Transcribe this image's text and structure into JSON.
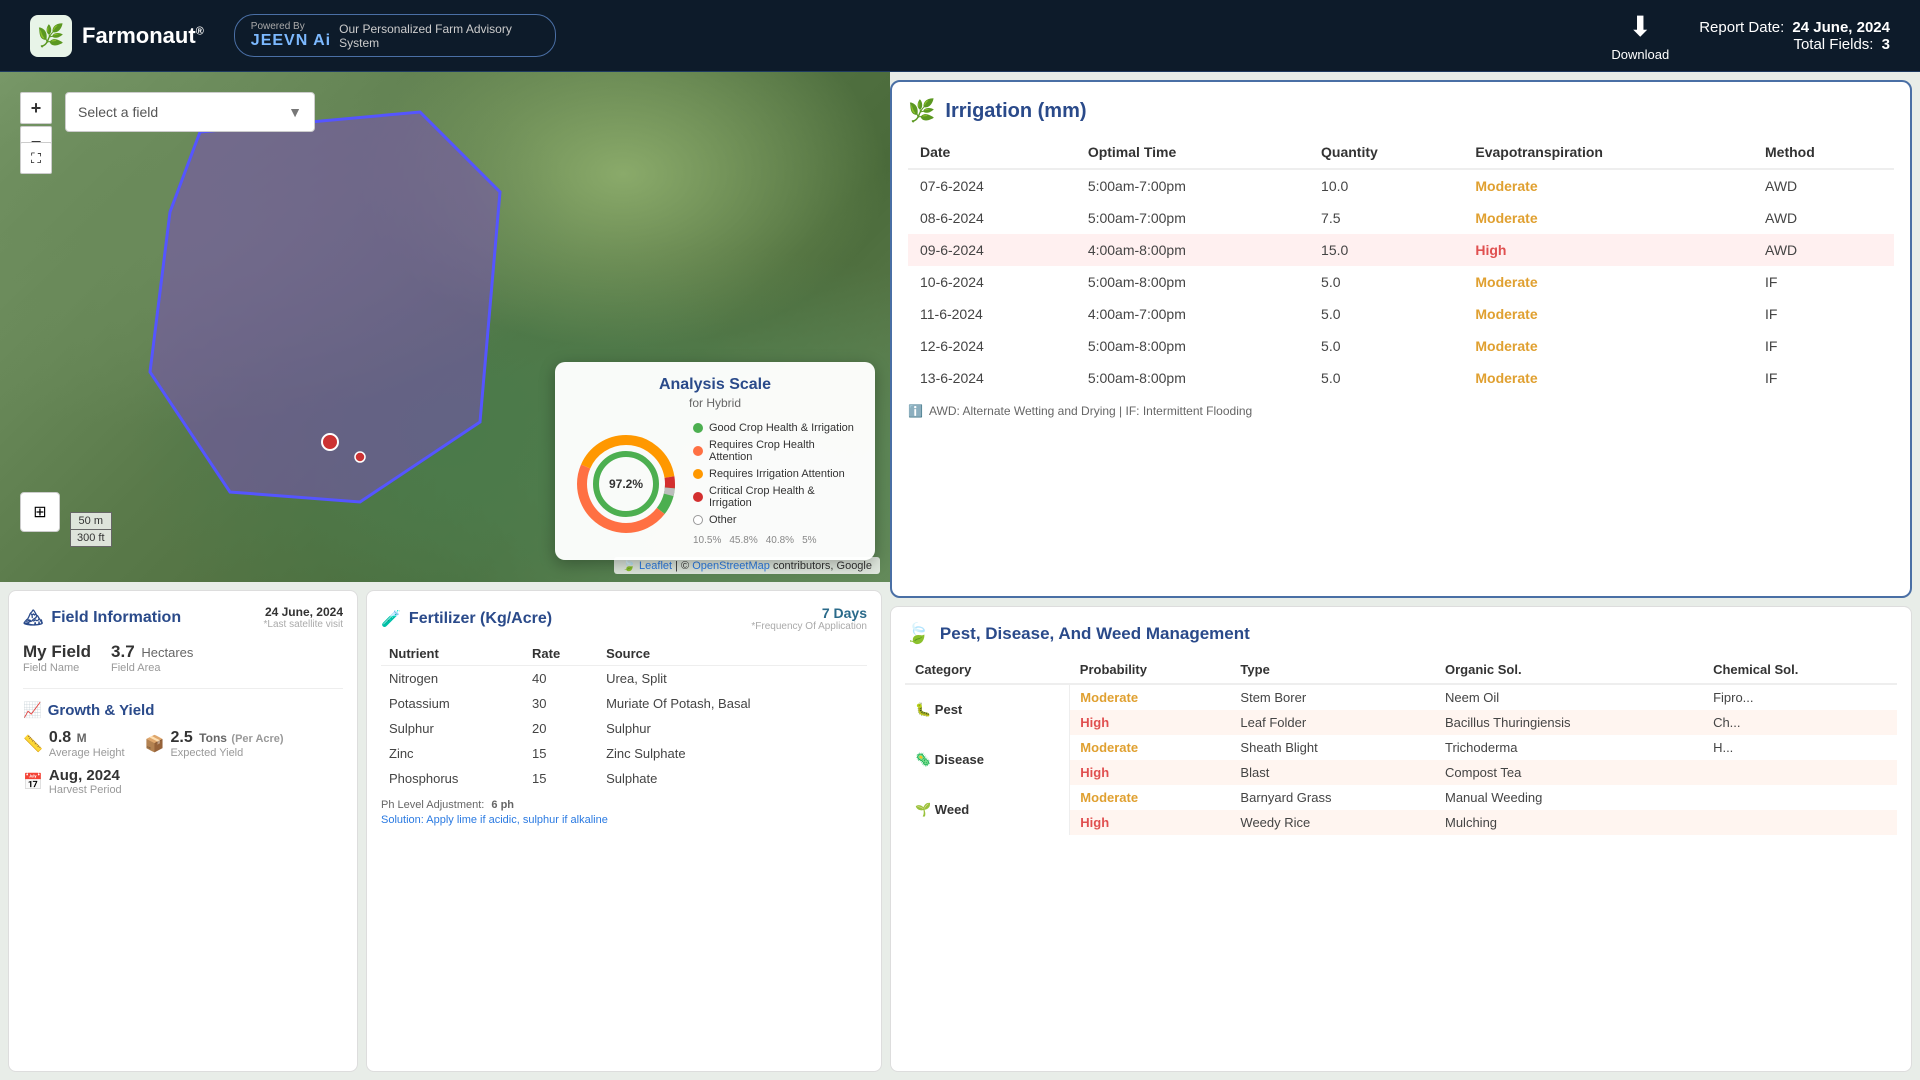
{
  "header": {
    "logo_text": "Farmonaut",
    "logo_reg": "®",
    "jeevn_name": "JEEVN Ai",
    "powered_by": "Powered By",
    "jeevn_subtitle": "Our Personalized Farm Advisory System",
    "download_label": "Download",
    "report_date_label": "Report Date:",
    "report_date_value": "24 June, 2024",
    "total_fields_label": "Total Fields:",
    "total_fields_value": "3"
  },
  "map": {
    "field_select_placeholder": "Select a field",
    "scale_m": "50 m",
    "scale_ft": "300 ft",
    "attribution": "Leaflet | © OpenStreetMap contributors, Google"
  },
  "analysis_scale": {
    "title": "Analysis Scale",
    "subtitle": "for Hybrid",
    "percent_97": "97.2%",
    "percent_10": "10.5%",
    "percent_45": "45.8%",
    "percent_40": "40.8%",
    "percent_5": "5%",
    "legend": [
      {
        "color": "#4caf50",
        "label": "Good Crop Health & Irrigation"
      },
      {
        "color": "#ff7043",
        "label": "Requires Crop Health Attention"
      },
      {
        "color": "#ff9800",
        "label": "Requires Irrigation Attention"
      },
      {
        "color": "#d32f2f",
        "label": "Critical Crop Health & Irrigation"
      },
      {
        "color": "#bdbdbd",
        "label": "Other",
        "border": true
      }
    ]
  },
  "field_info": {
    "title": "Field Information",
    "icon": "🏔",
    "date": "24 June, 2024",
    "last_satellite": "*Last satellite visit",
    "field_name_label": "Field Name",
    "field_name_value": "My Field",
    "field_area_label": "Field Area",
    "field_area_value": "3.7",
    "field_area_unit": "Hectares",
    "growth_title": "Growth & Yield",
    "avg_height_val": "0.8",
    "avg_height_unit": "M",
    "avg_height_label": "Average Height",
    "expected_yield_val": "2.5",
    "expected_yield_unit": "Tons",
    "expected_yield_per": "(Per Acre)",
    "expected_yield_label": "Expected Yield",
    "harvest_month": "Aug, 2024",
    "harvest_label": "Harvest Period"
  },
  "fertilizer": {
    "title": "Fertilizer (Kg/Acre)",
    "icon": "🧪",
    "freq_val": "7 Days",
    "freq_label": "*Frequency Of Application",
    "headers": [
      "Nutrient",
      "Rate",
      "Source"
    ],
    "rows": [
      {
        "nutrient": "Nitrogen",
        "rate": "40",
        "source": "Urea, Split"
      },
      {
        "nutrient": "Potassium",
        "rate": "30",
        "source": "Muriate Of Potash, Basal"
      },
      {
        "nutrient": "Sulphur",
        "rate": "20",
        "source": "Sulphur"
      },
      {
        "nutrient": "Zinc",
        "rate": "15",
        "source": "Zinc Sulphate"
      },
      {
        "nutrient": "Phosphorus",
        "rate": "15",
        "source": "Sulphate"
      }
    ],
    "ph_note": "Ph Level Adjustment:",
    "ph_val": "6 ph",
    "solution_text": "Solution: Apply lime if acidic, sulphur if alkaline"
  },
  "irrigation": {
    "title": "Irrigation (mm)",
    "icon": "🌿",
    "headers": [
      "Date",
      "Optimal Time",
      "Quantity",
      "Evapotranspiration",
      "Method"
    ],
    "rows": [
      {
        "date": "07-6-2024",
        "time": "5:00am-7:00pm",
        "qty": "10.0",
        "et": "Moderate",
        "method": "AWD",
        "highlight": false
      },
      {
        "date": "08-6-2024",
        "time": "5:00am-7:00pm",
        "qty": "7.5",
        "et": "Moderate",
        "method": "AWD",
        "highlight": false
      },
      {
        "date": "09-6-2024",
        "time": "4:00am-8:00pm",
        "qty": "15.0",
        "et": "High",
        "method": "AWD",
        "highlight": true
      },
      {
        "date": "10-6-2024",
        "time": "5:00am-8:00pm",
        "qty": "5.0",
        "et": "Moderate",
        "method": "IF",
        "highlight": false
      },
      {
        "date": "11-6-2024",
        "time": "4:00am-7:00pm",
        "qty": "5.0",
        "et": "Moderate",
        "method": "IF",
        "highlight": false
      },
      {
        "date": "12-6-2024",
        "time": "5:00am-8:00pm",
        "qty": "5.0",
        "et": "Moderate",
        "method": "IF",
        "highlight": false
      },
      {
        "date": "13-6-2024",
        "time": "5:00am-8:00pm",
        "qty": "5.0",
        "et": "Moderate",
        "method": "IF",
        "highlight": false
      }
    ],
    "note": "AWD: Alternate Wetting and Drying | IF: Intermittent Flooding"
  },
  "pest": {
    "title": "Pest, Disease, And Weed Management",
    "icon": "🍃",
    "headers": [
      "Category",
      "Probability",
      "Type",
      "Organic Sol.",
      "Chemical Sol."
    ],
    "categories": [
      {
        "name": "Pest",
        "icon": "🐛",
        "rows": [
          {
            "prob": "Moderate",
            "prob_class": "moderate",
            "type": "Stem Borer",
            "organic": "Neem Oil",
            "chemical": "Fipro...",
            "highlight": false
          },
          {
            "prob": "High",
            "prob_class": "high",
            "type": "Leaf Folder",
            "organic": "Bacillus Thuringiensis",
            "chemical": "Ch...",
            "highlight": true
          }
        ]
      },
      {
        "name": "Disease",
        "icon": "🦠",
        "rows": [
          {
            "prob": "Moderate",
            "prob_class": "moderate",
            "type": "Sheath Blight",
            "organic": "Trichoderma",
            "chemical": "H...",
            "highlight": false
          },
          {
            "prob": "High",
            "prob_class": "high",
            "type": "Blast",
            "organic": "Compost Tea",
            "chemical": "",
            "highlight": true
          }
        ]
      },
      {
        "name": "Weed",
        "icon": "🌱",
        "rows": [
          {
            "prob": "Moderate",
            "prob_class": "moderate",
            "type": "Barnyard Grass",
            "organic": "Manual Weeding",
            "chemical": "",
            "highlight": false
          },
          {
            "prob": "High",
            "prob_class": "high",
            "type": "Weedy Rice",
            "organic": "Mulching",
            "chemical": "",
            "highlight": true
          }
        ]
      }
    ]
  }
}
